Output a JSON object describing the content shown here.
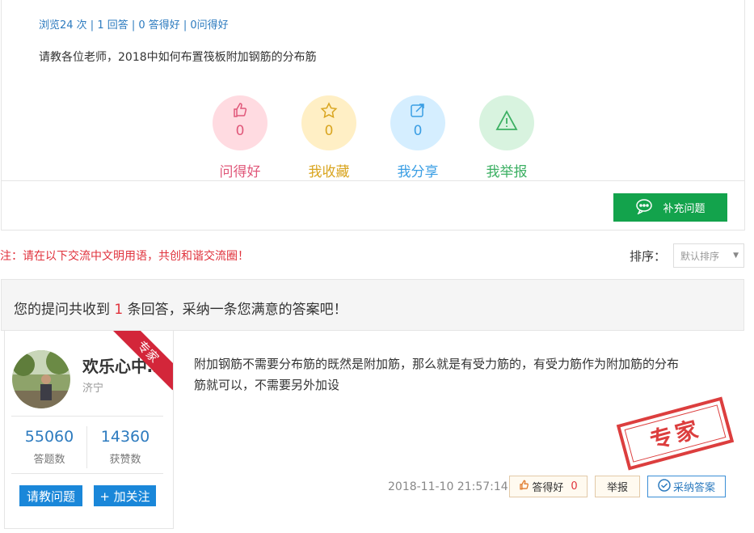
{
  "question": {
    "stats": "浏览24 次 | 1 回答 | 0 答得好 | 0问得好",
    "text": "请教各位老师，2018中如何布置筏板附加钢筋的分布筋",
    "actions": [
      {
        "label": "问得好",
        "count": "0",
        "icon": "thumbs-up-icon",
        "color": "#e0587a"
      },
      {
        "label": "我收藏",
        "count": "0",
        "icon": "star-icon",
        "color": "#d9a520"
      },
      {
        "label": "我分享",
        "count": "0",
        "icon": "share-icon",
        "color": "#3a9ee4"
      },
      {
        "label": "我举报",
        "count": "",
        "icon": "warning-icon",
        "color": "#3cb063"
      }
    ],
    "supplement_label": "补充问题"
  },
  "notice": "注：请在以下交流中文明用语，共创和谐交流圈！",
  "sort": {
    "label": "排序：",
    "selected": "默认排序"
  },
  "answers_header": {
    "prefix": "您的提问共收到",
    "count": "1",
    "suffix": "条回答，采纳一条您满意的答案吧！"
  },
  "answer": {
    "user": {
      "name": "欢乐心中…",
      "location": "济宁",
      "badge": "专家",
      "answers_count": "55060",
      "answers_label": "答题数",
      "likes_count": "14360",
      "likes_label": "获赞数",
      "ask_button": "请教问题",
      "follow_button": "+ 加关注"
    },
    "text": "附加钢筋不需要分布筋的既然是附加筋，那么就是有受力筋的，有受力筋作为附加筋的分布筋就可以，不需要另外加设",
    "stamp": "专家",
    "time": "2018-11-10 21:57:14",
    "good_label": "答得好",
    "good_count": "0",
    "report_label": "举报",
    "adopt_label": "采纳答案"
  },
  "colors": {
    "accent_green": "#13a34c",
    "accent_blue": "#1a87d9",
    "alert_red": "#e0323c"
  }
}
